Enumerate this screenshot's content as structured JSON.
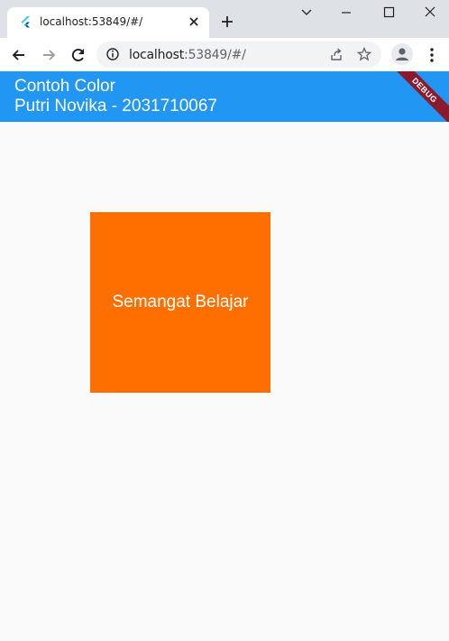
{
  "browser": {
    "tab": {
      "title": "localhost:53849/#/",
      "favicon": "flutter-icon"
    },
    "new_tab": "plus-icon",
    "window_controls": [
      "chevron-down-icon",
      "minimize-icon",
      "maximize-icon",
      "close-icon"
    ],
    "address": {
      "host": "localhost",
      "path": ":53849/#/"
    },
    "toolbar_icons": [
      "back-icon",
      "forward-icon",
      "reload-icon",
      "info-icon",
      "share-icon",
      "star-icon",
      "profile-icon",
      "menu-icon"
    ]
  },
  "app": {
    "bar_color": "#2196f3",
    "title_line1": "Contoh Color",
    "title_line2": "Putri Novika - 2031710067",
    "debug_banner": "DEBUG",
    "box": {
      "color": "#ff6f00",
      "label": "Semangat Belajar"
    }
  }
}
